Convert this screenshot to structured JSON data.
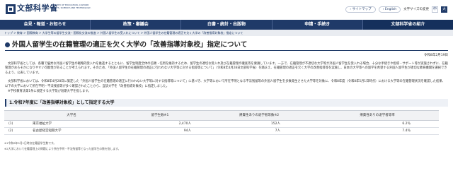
{
  "header": {
    "logo": "文部科学省",
    "logo_en": "MINISTRY OF EDUCATION, CULTURE, SPORTS, SCIENCE AND TECHNOLOGY-JAPAN",
    "sitemap": "サイトマップ",
    "english": "English",
    "font_size_label": "文字サイズの変更",
    "size_medium": "中",
    "size_large": "大"
  },
  "nav": [
    "会見・報道・お知らせ",
    "政策・審議会",
    "白書・統計・出版物",
    "申請・手続き",
    "文部科学省の紹介"
  ],
  "breadcrumb": "トップ > 教育 > 国際教育 > 大学生等の留学生交流・国際化交流の推進 > 外国人留学生の受入れについて > 外国人留学生の在籍管理の適正を欠く大学の「改善指導対象校」指定について",
  "page": {
    "title": "外国人留学生の在籍管理の適正を欠く大学の「改善指導対象校」指定について",
    "date": "令和8年2月19日",
    "para1": "文部科学省としては、各種で優秀な外国人留学生の戦略的受入れを推進するとともに、留学生制度全体の信頼・信用を維持するため、留学生の適切な受入れ及び在籍管理の徹底等を要請しています。一方で、在籍管理が不適切な大学等が外国人留学生を受入れる場合、十分な手続きや指導・サポート等が実施されずに、在籍管理がおろそかになりやすい可能性があることが考えられます。そのため、「外国人留学生の在籍管理の適正に行われない大学等に対する指導等について」（令和8年4月28日文部科学省）を踏まえ、在籍管理の適正を欠く大学の改善指導等を実施し、日本の大学等への留学を希望する外国人留学生が適切な教育機関を選択できるよう、公表しています。",
    "para2": "文部科学省においては、令和8年4月28日に策定した「外国人留学生の在籍管理の適正に行われない大学等に対する指導等について」に基づき、大学等において所在不明となる不法残留等の外国人留学生を多数発生させた大学等を対象に、令和8年度（令和8年5月1日時点）における大学等の在籍管理状況を確認した結果、以下の大学において所在不明・不法残留等が多く確認されたことから、当該大学を「改善指導対象校」に指定しました。",
    "para3": "※学校教育法第1条に規定する大学及び短期大学を指します。",
    "section_title": "1.令和7年度に「改善指導対象校」として指定する大学"
  },
  "table": {
    "headers": [
      "",
      "大学名",
      "留学生数※1",
      "帰責性ありの退学者等数※2",
      "帰責性ありの退学者等率"
    ],
    "rows": [
      [
        "(1)",
        "東京福祉大学",
        "2,470人",
        "152人",
        "6.2％"
      ],
      [
        "(2)",
        "名古屋経営短期大学",
        "94人",
        "7人",
        "7.4％"
      ]
    ]
  },
  "notes": [
    "※1令和6年5月1日時点在籍留学生数です。",
    "※2大学において在籍管理上の問題により所在不明・不法残留等となった留学生の数を指します。"
  ]
}
